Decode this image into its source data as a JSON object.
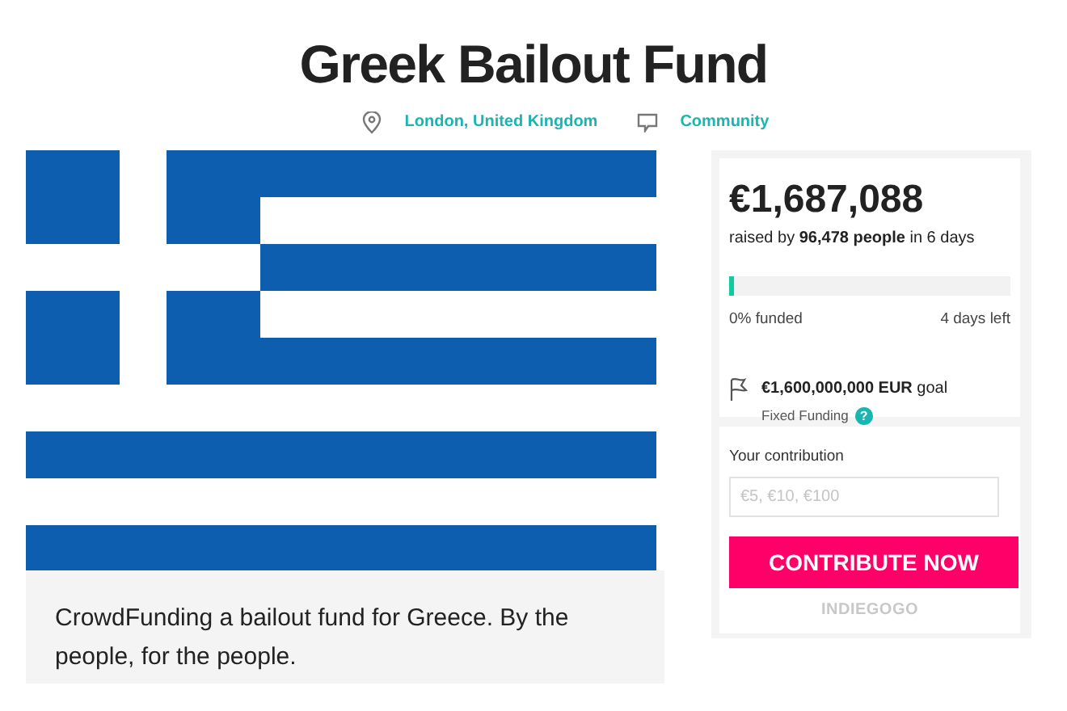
{
  "title": "Greek Bailout Fund",
  "meta": [
    {
      "kind": "location",
      "label": "London, United Kingdom"
    },
    {
      "kind": "category",
      "label": "Community"
    }
  ],
  "campaign_image": {
    "kind": "flag"
  },
  "description": "CrowdFunding a bailout fund for Greece. By the people, for the people.",
  "stats": {
    "raised": "€1,687,088",
    "raised_by": "raised by **96,478 people** in 6 days",
    "level": 0.02,
    "funded": "0% funded",
    "time_left": "4 days left",
    "goal": "**€1,600,000,000 EUR** goal",
    "funding_type": "Fixed Funding",
    "help": "?"
  },
  "contribution": {
    "label": "Your contribution",
    "placeholder": "€5, €10, €100",
    "button": "CONTRIBUTE NOW",
    "brand": "INDIEGOGO"
  }
}
